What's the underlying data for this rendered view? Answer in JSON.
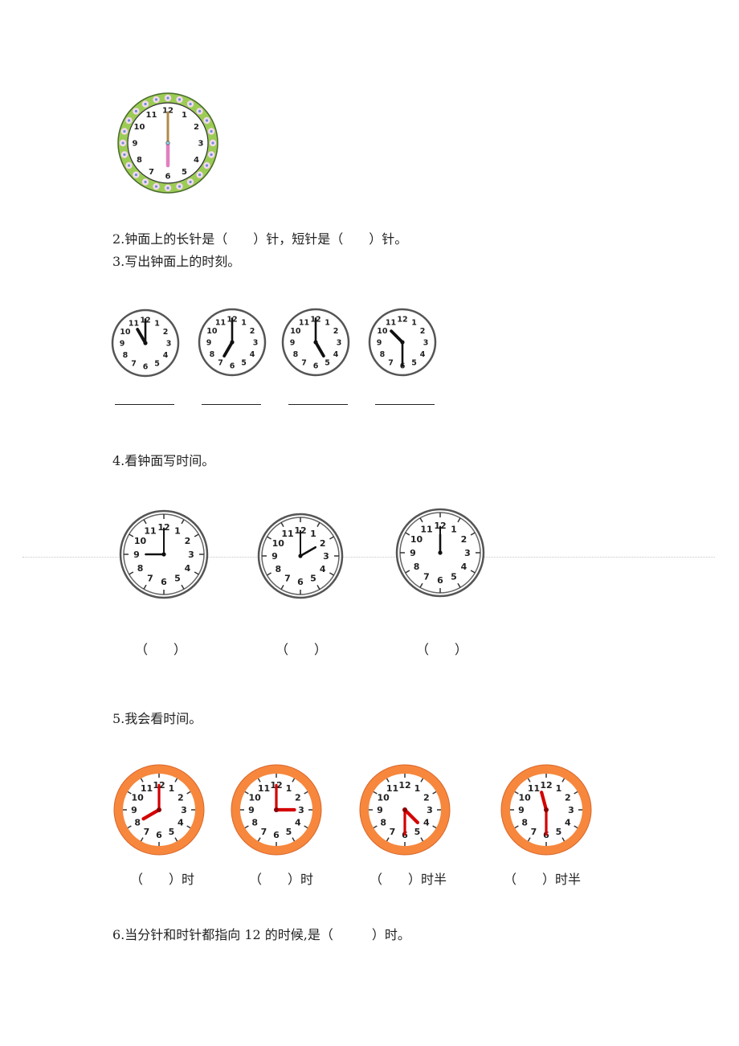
{
  "question2": "2.钟面上的长针是（　　）针，短针是（　　）针。",
  "question3": {
    "title": "3.写出钟面上的时刻。",
    "clocks": [
      {
        "hour": 11,
        "minute": 0
      },
      {
        "hour": 7,
        "minute": 0
      },
      {
        "hour": 5,
        "minute": 0
      },
      {
        "hour": 10,
        "minute": 30
      }
    ]
  },
  "question1_clock": {
    "hour": 6,
    "minute": 0,
    "style": "decorative-green-rim",
    "rim_color": "#9ccc55",
    "minute_hand_color": "#b08a4a",
    "hour_hand_color": "#e080c0"
  },
  "question4": {
    "title": "4.看钟面写时间。",
    "clocks": [
      {
        "hour": 9,
        "minute": 0
      },
      {
        "hour": 2,
        "minute": 0
      },
      {
        "hour": 12,
        "minute": 0
      }
    ],
    "answer_label": "（　　）"
  },
  "question5": {
    "title": "5.我会看时间。",
    "rim_color": "#f6873d",
    "hand_color": "#d40000",
    "clocks": [
      {
        "hour": 8,
        "minute": 0,
        "answer": "（　　）时"
      },
      {
        "hour": 3,
        "minute": 0,
        "answer": "（　　）时"
      },
      {
        "hour": 4,
        "minute": 30,
        "answer": "（　　）时半"
      },
      {
        "hour": 11,
        "minute": 30,
        "answer": "（　　）时半"
      }
    ]
  },
  "question6": "6.当分针和时针都指向 12 的时候,是（　　　）时。",
  "clock_numbers": [
    "12",
    "1",
    "2",
    "3",
    "4",
    "5",
    "6",
    "7",
    "8",
    "9",
    "10",
    "11"
  ]
}
